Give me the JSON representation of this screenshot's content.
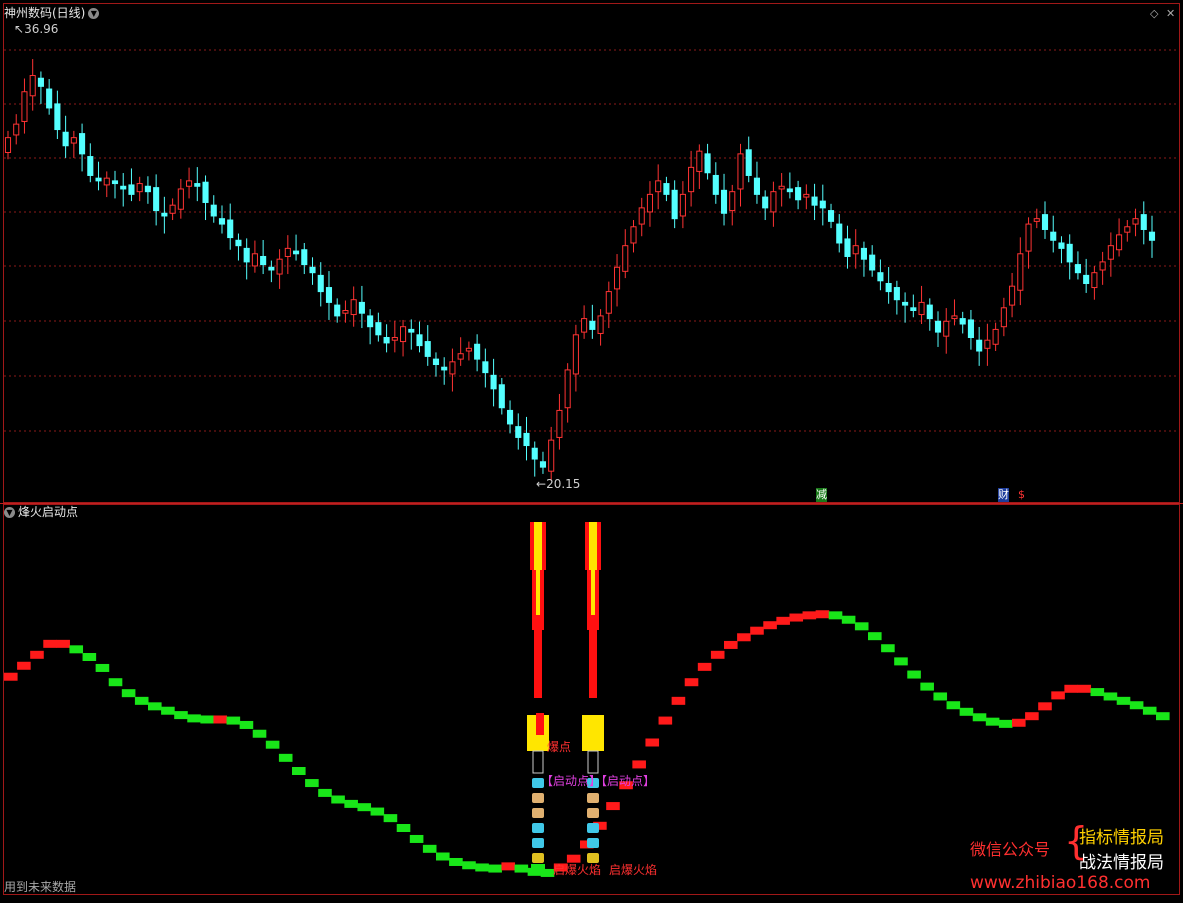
{
  "main_panel": {
    "title": "神州数码(日线)",
    "high_label": "36.96",
    "low_label": "20.15",
    "event_marks": [
      "减",
      "财",
      "$"
    ]
  },
  "indicator_panel": {
    "title": "烽火启动点",
    "footer_note": "用到未来数据",
    "annotations": {
      "explode": "爆点",
      "start1": "【启动点】",
      "start2": "【启动点】",
      "fire1": "启爆火焰",
      "fire2": "启爆火焰"
    }
  },
  "promo": {
    "wechat": "微信公众号",
    "brand1": "指标情报局",
    "brand2": "战法情报局",
    "url": "www.zhibiao168.com"
  },
  "colors": {
    "up": "#ff3333",
    "down": "#54ffff",
    "indicator_up": "#ff1a1a",
    "indicator_down": "#19e619",
    "grid": "#8b1a1a",
    "fire_yellow": "#ffe600"
  },
  "chart_data": [
    {
      "type": "candlestick",
      "title": "神州数码(日线)",
      "y_range": [
        20.15,
        36.96
      ],
      "annotated_extremes": {
        "high": 36.96,
        "low": 20.15
      },
      "closes": [
        32.9,
        33.4,
        34.6,
        35.2,
        34.8,
        34.0,
        33.2,
        32.6,
        32.9,
        32.3,
        31.5,
        31.3,
        31.4,
        31.2,
        31.0,
        30.8,
        31.2,
        30.9,
        30.2,
        30.0,
        30.4,
        31.0,
        31.3,
        31.1,
        30.5,
        30.0,
        29.7,
        29.2,
        28.9,
        28.3,
        28.6,
        28.2,
        28.0,
        28.4,
        28.8,
        28.6,
        28.2,
        27.9,
        27.2,
        26.8,
        26.3,
        26.5,
        26.9,
        26.4,
        25.9,
        25.6,
        25.3,
        25.5,
        25.9,
        25.7,
        25.2,
        24.8,
        24.5,
        24.3,
        24.6,
        24.9,
        25.1,
        24.7,
        24.2,
        23.6,
        22.9,
        22.3,
        21.8,
        21.5,
        21.0,
        20.7,
        21.7,
        22.8,
        24.3,
        25.6,
        26.2,
        25.8,
        26.3,
        27.2,
        28.1,
        28.9,
        29.6,
        30.3,
        30.8,
        31.3,
        30.8,
        29.9,
        30.8,
        31.8,
        32.4,
        31.6,
        30.8,
        30.1,
        30.9,
        32.3,
        31.5,
        30.8,
        30.3,
        30.9,
        31.1,
        30.9,
        30.6,
        30.8,
        30.4,
        30.3,
        29.8,
        29.0,
        28.5,
        28.9,
        28.4,
        28.0,
        27.6,
        27.2,
        26.9,
        26.7,
        26.5,
        26.8,
        26.2,
        25.7,
        26.1,
        26.3,
        26.0,
        25.5,
        25.0,
        25.4,
        25.8,
        26.6,
        27.4,
        28.6,
        29.7,
        29.9,
        29.5,
        29.1,
        28.8,
        28.3,
        27.9,
        27.5,
        27.9,
        28.3,
        28.9,
        29.3,
        29.6,
        29.9,
        29.5,
        29.1
      ]
    },
    {
      "type": "line",
      "title": "烽火启动点",
      "colored_by_direction": true,
      "values": [
        55,
        56,
        57,
        58,
        58,
        57.5,
        56.8,
        55.8,
        54.5,
        53.5,
        52.8,
        52.3,
        51.9,
        51.5,
        51.2,
        51.1,
        51.1,
        51.0,
        50.6,
        49.8,
        48.8,
        47.6,
        46.4,
        45.3,
        44.4,
        43.8,
        43.4,
        43.1,
        42.7,
        42.1,
        41.2,
        40.2,
        39.3,
        38.6,
        38.1,
        37.8,
        37.6,
        37.5,
        37.7,
        37.5,
        37.2,
        37.1,
        37.6,
        38.4,
        39.7,
        41.4,
        43.2,
        45.1,
        47.0,
        49.0,
        51.0,
        52.8,
        54.5,
        55.9,
        57.0,
        57.9,
        58.6,
        59.2,
        59.7,
        60.1,
        60.4,
        60.6,
        60.7,
        60.6,
        60.2,
        59.6,
        58.7,
        57.6,
        56.4,
        55.2,
        54.1,
        53.2,
        52.4,
        51.8,
        51.3,
        50.9,
        50.7,
        50.8,
        51.4,
        52.3,
        53.3,
        53.9,
        53.9,
        53.6,
        53.2,
        52.8,
        52.4,
        51.9,
        51.4
      ]
    }
  ]
}
